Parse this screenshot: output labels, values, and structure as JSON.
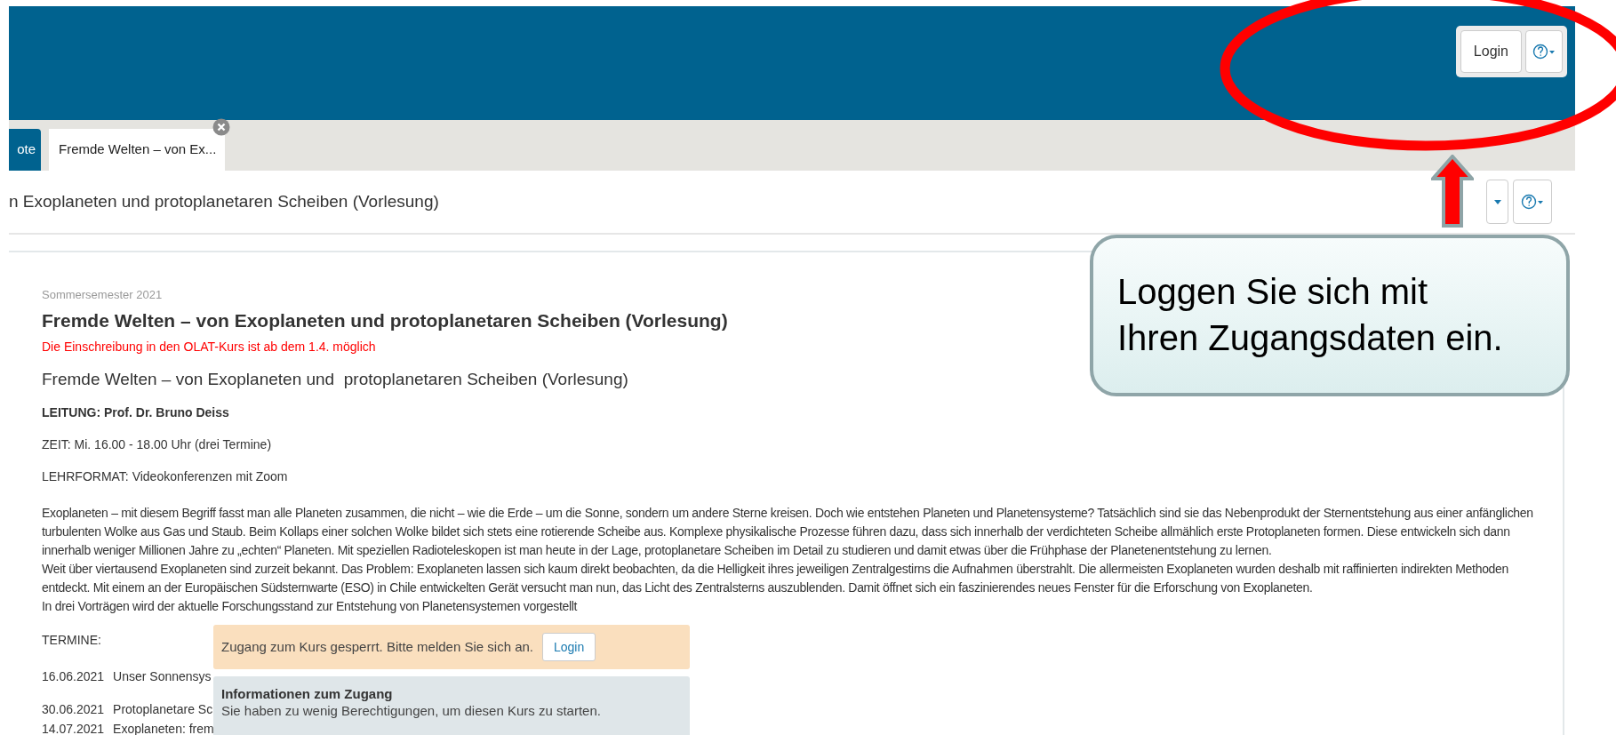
{
  "header": {
    "buttons": [
      {
        "kind": "text",
        "label": "Login"
      },
      {
        "kind": "help"
      }
    ]
  },
  "tabs": [
    {
      "label": "ote",
      "selected": false,
      "closable": false
    },
    {
      "label": "Fremde Welten – von Ex...",
      "selected": true,
      "closable": true
    }
  ],
  "page_title": "n Exoplaneten und protoplanetaren Scheiben (Vorlesung)",
  "toolbar_buttons": [
    {
      "kind": "caret"
    },
    {
      "kind": "help"
    }
  ],
  "course": {
    "semester": "Sommersemester 2021",
    "title": "Fremde Welten – von Exoplaneten und protoplanetaren Scheiben (Vorlesung)",
    "notice": "Die Einschreibung in den OLAT-Kurs ist ab dem 1.4. möglich",
    "subtitle": "Fremde Welten – von Exoplaneten und  protoplanetaren Scheiben (Vorlesung)",
    "facts": [
      {
        "text": "LEITUNG: Prof. Dr. Bruno Deiss",
        "bold": true
      },
      {
        "text": "ZEIT: Mi. 16.00 - 18.00 Uhr (drei Termine)",
        "bold": false
      },
      {
        "text": "LEHRFORMAT: Videokonferenzen mit Zoom",
        "bold": false
      }
    ],
    "paragraphs": [
      "Exoplaneten – mit diesem Begriff fasst man alle Planeten zusammen, die nicht – wie die Erde – um die Sonne, sondern um andere Sterne kreisen. Doch wie entstehen Planeten und Planetensysteme? Tatsächlich sind sie das Nebenprodukt der Sternentstehung aus einer anfänglichen turbulenten Wolke aus Gas und Staub. Beim Kollaps einer solchen Wolke bildet sich stets eine rotierende Scheibe aus. Komplexe physikalische Prozesse führen dazu, dass sich innerhalb der verdichteten Scheibe allmählich erste Protoplaneten formen. Diese entwickeln sich dann innerhalb weniger Millionen Jahre zu „echten“ Planeten. Mit speziellen Radioteleskopen ist man heute in der Lage, protoplanetare Scheiben im Detail zu studieren und damit etwas über die Frühphase der Planetenentstehung zu lernen.",
      "Weit über viertausend Exoplaneten sind zurzeit bekannt. Das Problem: Exoplaneten lassen sich kaum direkt beobachten, da die Helligkeit ihres jeweiligen Zentralgestirns die Aufnahmen überstrahlt. Die allermeisten Exoplaneten wurden deshalb mit raffinierten indirekten Methoden entdeckt. Mit einem an der Europäischen Südsternwarte (ESO) in Chile entwickelten Gerät versucht man nun, das Licht des Zentralsterns auszublenden. Damit öffnet sich ein faszinierendes neues Fenster für die Erforschung von Exoplaneten.",
      "In drei Vorträgen wird der aktuelle Forschungsstand zur Entstehung von Planetensystemen vorgestellt"
    ],
    "termine_label": "TERMINE:",
    "dates": [
      {
        "date": "16.06.2021",
        "title": "Unser Sonnensys"
      },
      {
        "date": "30.06.2021",
        "title": "Protoplanetare Sc"
      },
      {
        "date": "14.07.2021",
        "title": "Exoplaneten: frem"
      }
    ]
  },
  "access_notice": {
    "message": "Zugang zum Kurs gesperrt. Bitte melden Sie sich an.",
    "button": "Login"
  },
  "access_info": {
    "title": "Informationen zum Zugang",
    "text": "Sie haben zu wenig Berechtigungen, um diesen Kurs zu starten."
  },
  "callout": "Loggen Sie sich mit\nIhren Zugangsdaten ein."
}
